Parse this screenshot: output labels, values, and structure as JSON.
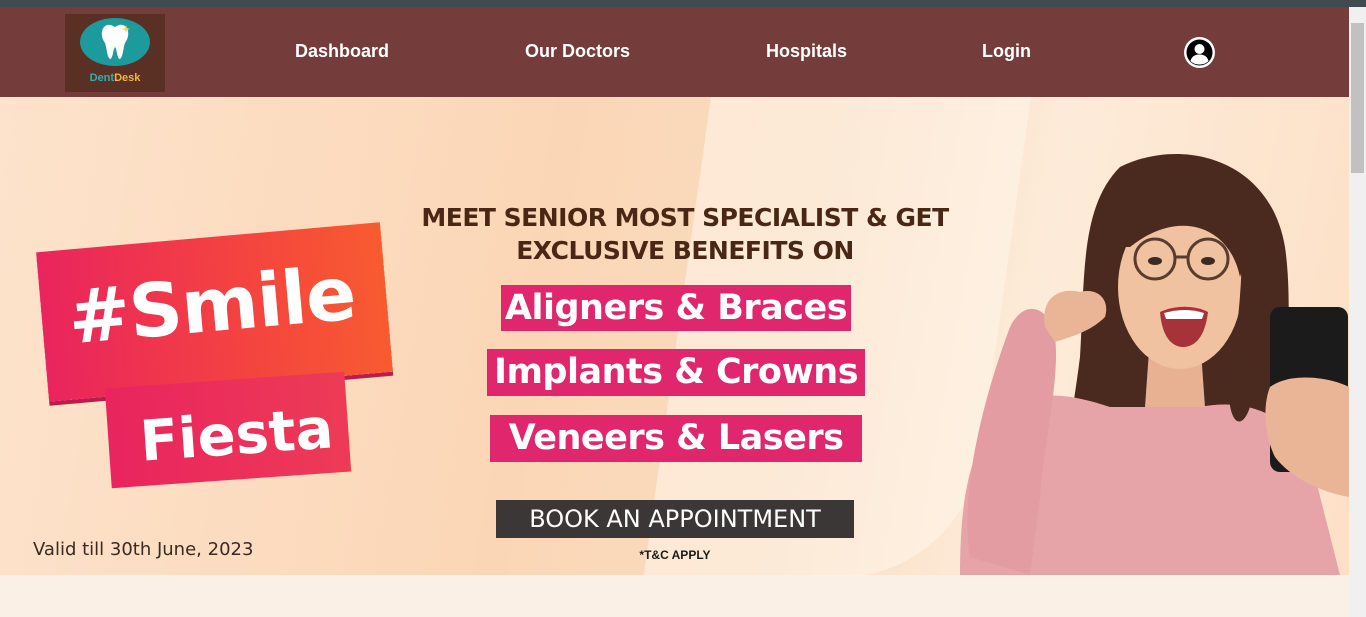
{
  "brand": {
    "name_part1": "Dent",
    "name_part2": "Desk"
  },
  "nav": {
    "items": [
      {
        "label": "Dashboard"
      },
      {
        "label": "Our Doctors"
      },
      {
        "label": "Hospitals"
      },
      {
        "label": "Login"
      }
    ],
    "profile_icon": "user-circle-icon"
  },
  "banner": {
    "tag_line1": "#Smile",
    "tag_line2": "Fiesta",
    "valid_text": "Valid till 30th June, 2023",
    "headline_line1": "MEET SENIOR MOST SPECIALIST & GET",
    "headline_line2": "EXCLUSIVE BENEFITS ON",
    "services": [
      {
        "label": "Aligners & Braces"
      },
      {
        "label": "Implants & Crowns"
      },
      {
        "label": "Veneers & Lasers"
      }
    ],
    "cta_label": "BOOK AN APPOINTMENT",
    "terms": "*T&C APPLY"
  },
  "colors": {
    "navbar": "#743d3b",
    "accent_pink": "#e0266d",
    "cta_bg": "#3b3737"
  }
}
